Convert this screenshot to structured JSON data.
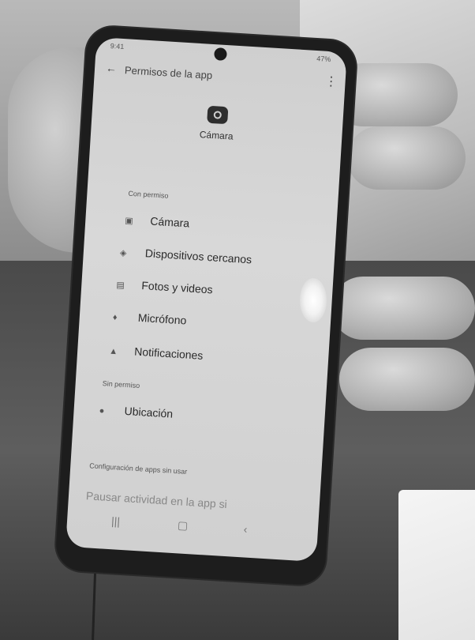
{
  "app_bar": {
    "title": "Permisos de la app"
  },
  "status_bar": {
    "time": "9:41",
    "right": "47%"
  },
  "header": {
    "title": "Cámara"
  },
  "sections": {
    "with_permission": "Con permiso",
    "without_permission": "Sin permiso",
    "unused_apps": "Configuración de apps sin usar"
  },
  "permissions_allowed": [
    {
      "label": "Cámara",
      "icon": "camera-icon"
    },
    {
      "label": "Dispositivos cercanos",
      "icon": "nearby-devices-icon"
    },
    {
      "label": "Fotos y videos",
      "icon": "photos-icon"
    },
    {
      "label": "Micrófono",
      "icon": "microphone-icon"
    },
    {
      "label": "Notificaciones",
      "icon": "bell-icon"
    }
  ],
  "permissions_denied": [
    {
      "label": "Ubicación",
      "icon": "location-icon"
    }
  ],
  "pause_setting": {
    "label": "Pausar actividad en la app si"
  },
  "nav": {
    "recents": "|||",
    "home": "▢",
    "back": "‹"
  }
}
